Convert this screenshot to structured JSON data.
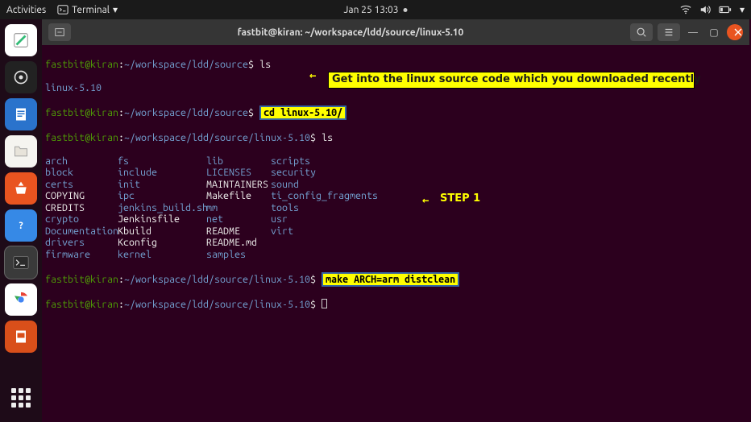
{
  "top": {
    "activities": "Activities",
    "app_name": "Terminal",
    "datetime": "Jan 25  13:03"
  },
  "titlebar": {
    "title": "fastbit@kiran: ~/workspace/ldd/source/linux-5.10"
  },
  "prompt": {
    "userhost": "fastbit@kiran",
    "path1": "~/workspace/ldd/source",
    "path2": "~/workspace/ldd/source/linux-5.10"
  },
  "commands": {
    "ls": "ls",
    "cd": "cd linux-5.10/",
    "ls2": "ls",
    "make": "make ARCH=arm distclean"
  },
  "dir_single": "linux-5.10",
  "annotations": {
    "get_into": "Get into the linux source code which you downloaded recently",
    "step1": "STEP 1"
  },
  "listing": [
    {
      "c1": "arch",
      "c2": "fs",
      "c3": "lib",
      "c4": "scripts",
      "t1": "d",
      "t2": "d",
      "t3": "d",
      "t4": "d"
    },
    {
      "c1": "block",
      "c2": "include",
      "c3": "LICENSES",
      "c4": "security",
      "t1": "d",
      "t2": "d",
      "t3": "d",
      "t4": "d"
    },
    {
      "c1": "certs",
      "c2": "init",
      "c3": "MAINTAINERS",
      "c4": "sound",
      "t1": "d",
      "t2": "d",
      "t3": "f",
      "t4": "d"
    },
    {
      "c1": "COPYING",
      "c2": "ipc",
      "c3": "Makefile",
      "c4": "ti_config_fragments",
      "t1": "f",
      "t2": "d",
      "t3": "f",
      "t4": "d"
    },
    {
      "c1": "CREDITS",
      "c2": "jenkins_build.sh",
      "c3": "mm",
      "c4": "tools",
      "t1": "f",
      "t2": "d",
      "t3": "d",
      "t4": "d"
    },
    {
      "c1": "crypto",
      "c2": "Jenkinsfile",
      "c3": "net",
      "c4": "usr",
      "t1": "d",
      "t2": "f",
      "t3": "d",
      "t4": "d"
    },
    {
      "c1": "Documentation",
      "c2": "Kbuild",
      "c3": "README",
      "c4": "virt",
      "t1": "d",
      "t2": "f",
      "t3": "f",
      "t4": "d"
    },
    {
      "c1": "drivers",
      "c2": "Kconfig",
      "c3": "README.md",
      "c4": "",
      "t1": "d",
      "t2": "f",
      "t3": "f",
      "t4": ""
    },
    {
      "c1": "firmware",
      "c2": "kernel",
      "c3": "samples",
      "c4": "",
      "t1": "d",
      "t2": "d",
      "t3": "d",
      "t4": ""
    }
  ]
}
